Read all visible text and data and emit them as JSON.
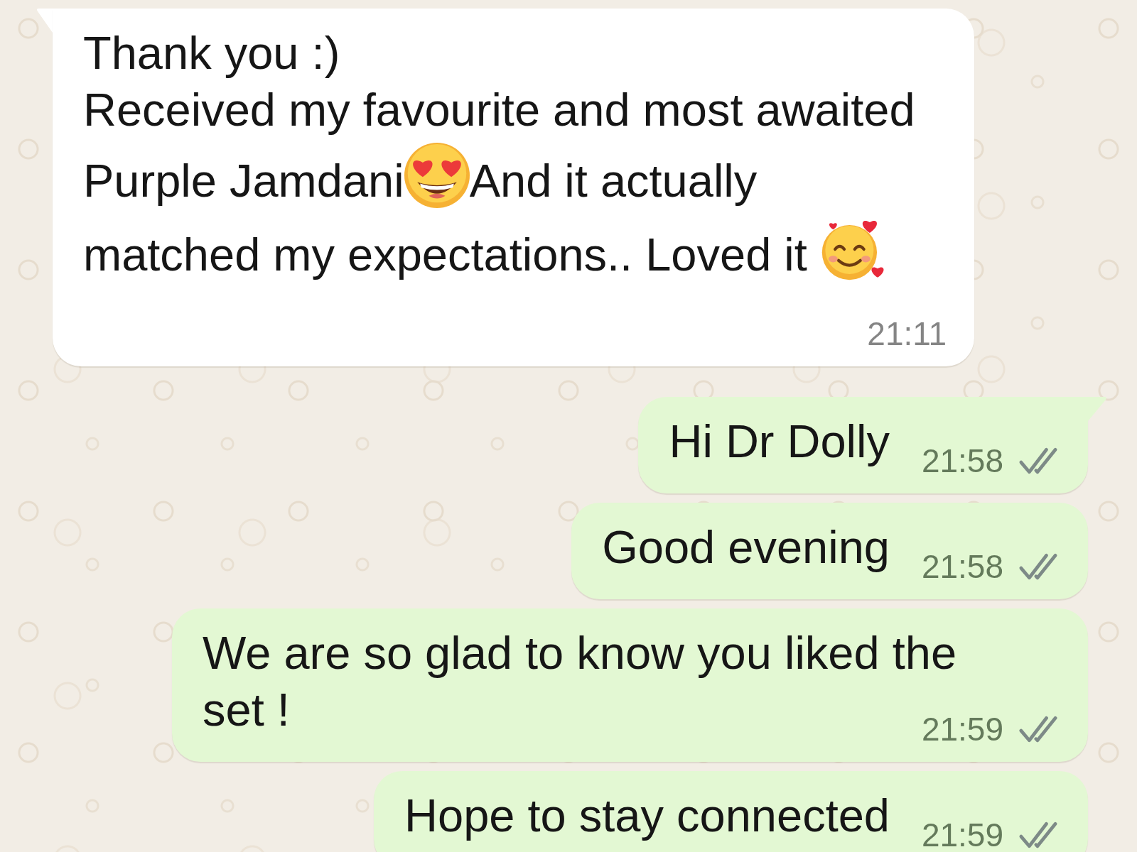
{
  "messages": [
    {
      "kind": "incoming",
      "lines": [
        {
          "parts": [
            {
              "kind": "text",
              "text": "Thank you :)"
            }
          ]
        },
        {
          "parts": [
            {
              "kind": "text",
              "text": "Received my favourite and most awaited"
            }
          ]
        },
        {
          "parts": [
            {
              "kind": "text",
              "text": "Purple Jamdani"
            },
            {
              "kind": "heart_eyes"
            },
            {
              "kind": "text",
              "text": "And it actually"
            }
          ]
        },
        {
          "parts": [
            {
              "kind": "text",
              "text": "matched my expectations.. Loved it "
            },
            {
              "kind": "smiling_hearts"
            }
          ]
        }
      ],
      "time": "21:11"
    },
    {
      "kind": "outgoing",
      "lines": [
        {
          "parts": [
            {
              "kind": "text",
              "text": "Hi Dr Dolly"
            }
          ]
        }
      ],
      "time": "21:58",
      "read": false
    },
    {
      "kind": "outgoing",
      "lines": [
        {
          "parts": [
            {
              "kind": "text",
              "text": "Good evening"
            }
          ]
        }
      ],
      "time": "21:58",
      "read": false
    },
    {
      "kind": "outgoing",
      "lines": [
        {
          "parts": [
            {
              "kind": "text",
              "text": "We are so glad to know you liked the"
            }
          ]
        },
        {
          "parts": [
            {
              "kind": "text",
              "text": "set !"
            }
          ]
        }
      ],
      "time": "21:59",
      "read": false
    },
    {
      "kind": "outgoing",
      "lines": [
        {
          "parts": [
            {
              "kind": "text",
              "text": "Hope to stay connected"
            }
          ]
        }
      ],
      "time": "21:59",
      "read": false
    }
  ]
}
